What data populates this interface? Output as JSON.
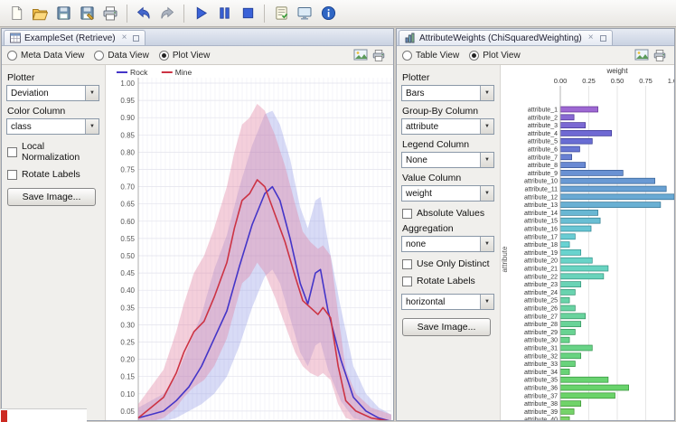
{
  "toolbar": {
    "buttons": [
      "new",
      "open",
      "save",
      "save-as",
      "print",
      "sep",
      "undo",
      "redo",
      "sep",
      "run",
      "pause",
      "stop",
      "sep",
      "validate",
      "monitor",
      "info"
    ]
  },
  "left_panel": {
    "tab_title": "ExampleSet (Retrieve)",
    "tab_icons": [
      "close-icon",
      "detach-icon"
    ],
    "viewbar_icons": [
      "export-image-icon",
      "print-icon"
    ],
    "views": [
      {
        "label": "Meta Data View",
        "selected": false
      },
      {
        "label": "Data View",
        "selected": false
      },
      {
        "label": "Plot View",
        "selected": true
      }
    ],
    "controls": {
      "plotter_label": "Plotter",
      "plotter_value": "Deviation",
      "color_column_label": "Color Column",
      "color_column_value": "class",
      "local_normalization_label": "Local Normalization",
      "rotate_labels_label": "Rotate Labels",
      "save_image_label": "Save Image..."
    }
  },
  "right_panel": {
    "tab_title": "AttributeWeights (ChiSquaredWeighting)",
    "tab_icons": [
      "close-icon",
      "detach-icon"
    ],
    "viewbar_icons": [
      "export-image-icon",
      "print-icon"
    ],
    "views": [
      {
        "label": "Table View",
        "selected": false
      },
      {
        "label": "Plot View",
        "selected": true
      }
    ],
    "controls": {
      "plotter_label": "Plotter",
      "plotter_value": "Bars",
      "group_by_label": "Group-By Column",
      "group_by_value": "attribute",
      "legend_column_label": "Legend Column",
      "legend_column_value": "None",
      "value_column_label": "Value Column",
      "value_column_value": "weight",
      "absolute_values_label": "Absolute Values",
      "aggregation_label": "Aggregation",
      "aggregation_value": "none",
      "use_only_distinct_label": "Use Only Distinct",
      "rotate_labels_label": "Rotate Labels",
      "orientation_value": "horizontal",
      "save_image_label": "Save Image..."
    }
  },
  "chart_data": [
    {
      "type": "area",
      "title": "",
      "grid": true,
      "legend_position": "top-left",
      "ylim": [
        0.0,
        1.0
      ],
      "y_ticks": [
        1.0,
        0.95,
        0.9,
        0.85,
        0.8,
        0.75,
        0.7,
        0.65,
        0.6,
        0.55,
        0.5,
        0.45,
        0.4,
        0.35,
        0.3,
        0.25,
        0.2,
        0.15,
        0.1,
        0.05
      ],
      "series": [
        {
          "name": "Rock",
          "color": "#4435c8",
          "band_color": "rgba(125,135,225,0.30)",
          "points": [
            [
              0.0,
              0.03,
              0.01,
              0.06
            ],
            [
              0.05,
              0.04,
              0.01,
              0.08
            ],
            [
              0.1,
              0.05,
              0.02,
              0.1
            ],
            [
              0.15,
              0.08,
              0.03,
              0.15
            ],
            [
              0.2,
              0.12,
              0.05,
              0.24
            ],
            [
              0.25,
              0.18,
              0.07,
              0.33
            ],
            [
              0.3,
              0.26,
              0.1,
              0.46
            ],
            [
              0.35,
              0.34,
              0.15,
              0.56
            ],
            [
              0.4,
              0.47,
              0.24,
              0.7
            ],
            [
              0.45,
              0.59,
              0.35,
              0.82
            ],
            [
              0.5,
              0.68,
              0.44,
              0.91
            ],
            [
              0.53,
              0.7,
              0.46,
              0.92
            ],
            [
              0.56,
              0.66,
              0.42,
              0.88
            ],
            [
              0.6,
              0.55,
              0.32,
              0.78
            ],
            [
              0.64,
              0.42,
              0.22,
              0.64
            ],
            [
              0.67,
              0.36,
              0.18,
              0.58
            ],
            [
              0.7,
              0.45,
              0.24,
              0.66
            ],
            [
              0.72,
              0.46,
              0.25,
              0.67
            ],
            [
              0.75,
              0.34,
              0.17,
              0.54
            ],
            [
              0.8,
              0.2,
              0.08,
              0.35
            ],
            [
              0.85,
              0.09,
              0.03,
              0.18
            ],
            [
              0.9,
              0.05,
              0.02,
              0.1
            ],
            [
              0.95,
              0.03,
              0.01,
              0.06
            ],
            [
              1.0,
              0.02,
              0.01,
              0.04
            ]
          ]
        },
        {
          "name": "Mine",
          "color": "#cc3344",
          "band_color": "rgba(225,130,160,0.38)",
          "points": [
            [
              0.0,
              0.03,
              0.01,
              0.07
            ],
            [
              0.05,
              0.06,
              0.02,
              0.12
            ],
            [
              0.1,
              0.09,
              0.03,
              0.17
            ],
            [
              0.15,
              0.16,
              0.06,
              0.28
            ],
            [
              0.18,
              0.22,
              0.09,
              0.36
            ],
            [
              0.22,
              0.28,
              0.12,
              0.45
            ],
            [
              0.26,
              0.31,
              0.14,
              0.5
            ],
            [
              0.3,
              0.38,
              0.18,
              0.58
            ],
            [
              0.35,
              0.48,
              0.26,
              0.7
            ],
            [
              0.38,
              0.58,
              0.34,
              0.8
            ],
            [
              0.41,
              0.66,
              0.42,
              0.88
            ],
            [
              0.44,
              0.68,
              0.44,
              0.9
            ],
            [
              0.47,
              0.72,
              0.48,
              0.94
            ],
            [
              0.5,
              0.7,
              0.45,
              0.92
            ],
            [
              0.54,
              0.62,
              0.38,
              0.85
            ],
            [
              0.58,
              0.54,
              0.3,
              0.76
            ],
            [
              0.62,
              0.44,
              0.22,
              0.65
            ],
            [
              0.65,
              0.37,
              0.18,
              0.57
            ],
            [
              0.68,
              0.35,
              0.16,
              0.54
            ],
            [
              0.71,
              0.33,
              0.15,
              0.52
            ],
            [
              0.73,
              0.35,
              0.16,
              0.53
            ],
            [
              0.76,
              0.32,
              0.14,
              0.5
            ],
            [
              0.79,
              0.18,
              0.07,
              0.33
            ],
            [
              0.82,
              0.08,
              0.03,
              0.17
            ],
            [
              0.86,
              0.05,
              0.02,
              0.1
            ],
            [
              0.92,
              0.03,
              0.01,
              0.06
            ],
            [
              1.0,
              0.02,
              0.01,
              0.04
            ]
          ]
        }
      ]
    },
    {
      "type": "bar",
      "orientation": "horizontal",
      "title": "weight",
      "ylabel": "attribute",
      "xlim": [
        0,
        1
      ],
      "x_ticks": [
        0.0,
        0.25,
        0.5,
        0.75,
        1.0
      ],
      "categories": [
        "attribute_1",
        "attribute_2",
        "attribute_3",
        "attribute_4",
        "attribute_5",
        "attribute_6",
        "attribute_7",
        "attribute_8",
        "attribute_9",
        "attribute_10",
        "attribute_11",
        "attribute_12",
        "attribute_13",
        "attribute_14",
        "attribute_15",
        "attribute_16",
        "attribute_17",
        "attribute_18",
        "attribute_19",
        "attribute_20",
        "attribute_21",
        "attribute_22",
        "attribute_23",
        "attribute_24",
        "attribute_25",
        "attribute_26",
        "attribute_27",
        "attribute_28",
        "attribute_29",
        "attribute_30",
        "attribute_31",
        "attribute_32",
        "attribute_33",
        "attribute_34",
        "attribute_35",
        "attribute_36",
        "attribute_37",
        "attribute_38",
        "attribute_39",
        "attribute_40"
      ],
      "values": [
        0.33,
        0.12,
        0.22,
        0.45,
        0.28,
        0.17,
        0.1,
        0.22,
        0.55,
        0.83,
        0.93,
        1.0,
        0.88,
        0.33,
        0.35,
        0.27,
        0.13,
        0.08,
        0.18,
        0.28,
        0.42,
        0.38,
        0.18,
        0.13,
        0.08,
        0.13,
        0.22,
        0.18,
        0.13,
        0.08,
        0.28,
        0.18,
        0.13,
        0.08,
        0.42,
        0.6,
        0.48,
        0.18,
        0.12,
        0.08
      ]
    }
  ]
}
